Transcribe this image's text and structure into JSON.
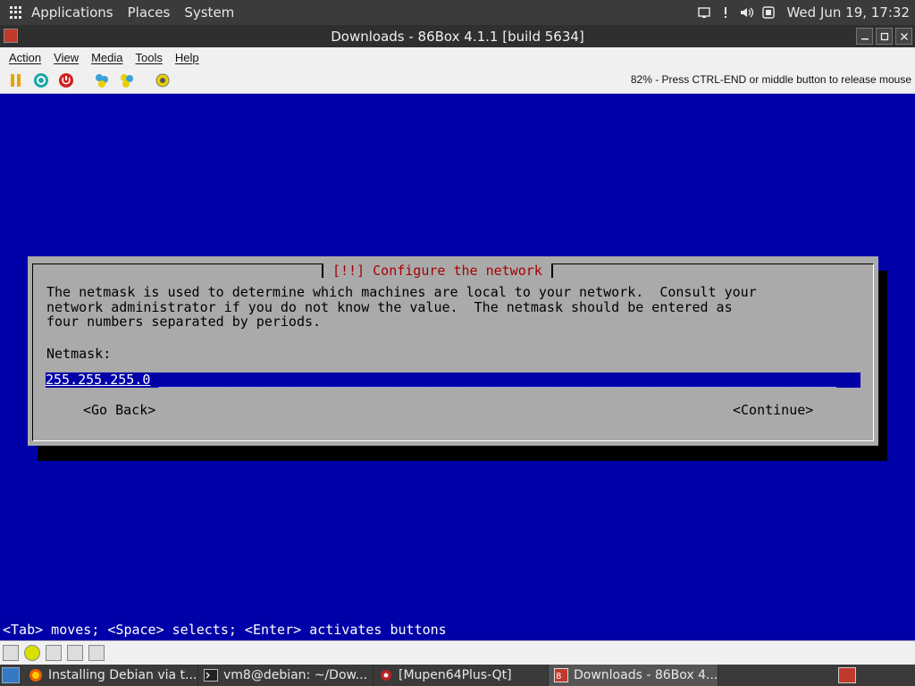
{
  "top_panel": {
    "menus": [
      "Applications",
      "Places",
      "System"
    ],
    "clock": "Wed Jun 19, 17:32"
  },
  "window": {
    "title": "Downloads - 86Box 4.1.1 [build 5634]"
  },
  "menubar": {
    "items": [
      "Action",
      "View",
      "Media",
      "Tools",
      "Help"
    ]
  },
  "toolbar": {
    "status_message": "82% - Press CTRL-END or middle button to release mouse"
  },
  "installer": {
    "dialog_title": "[!!] Configure the network",
    "description_lines": [
      "The netmask is used to determine which machines are local to your network.  Consult your",
      "network administrator if you do not know the value.  The netmask should be entered as",
      "four numbers separated by periods."
    ],
    "field_label": "Netmask:",
    "field_value": "255.255.255.0",
    "go_back_label": "<Go Back>",
    "continue_label": "<Continue>",
    "help_line": "<Tab> moves; <Space> selects; <Enter> activates buttons"
  },
  "taskbar": {
    "tasks": [
      {
        "label": "Installing Debian via t...",
        "icon": "firefox-icon"
      },
      {
        "label": "vm8@debian: ~/Dow...",
        "icon": "terminal-icon"
      },
      {
        "label": "[Mupen64Plus-Qt]",
        "icon": "mupen-icon"
      },
      {
        "label": "Downloads - 86Box 4....",
        "icon": "86box-icon",
        "active": true
      }
    ]
  },
  "colors": {
    "screen_bg": "#0000a8",
    "dialog_bg": "#aaaaaa",
    "dialog_title": "#a80000"
  }
}
